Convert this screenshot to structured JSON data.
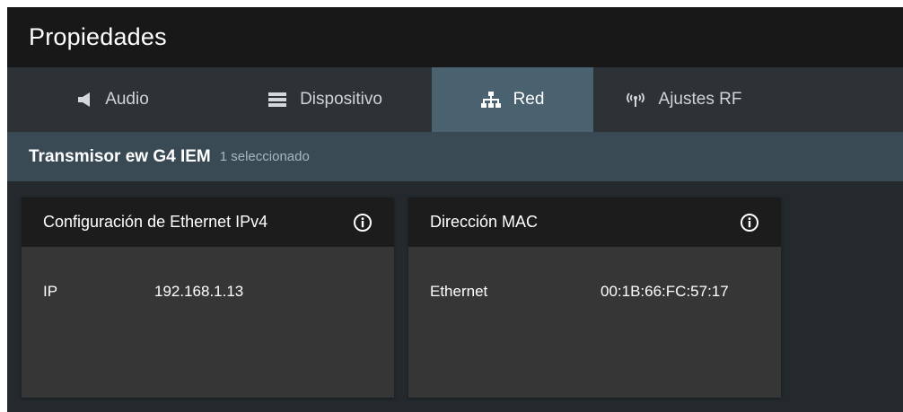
{
  "window": {
    "title": "Propiedades"
  },
  "tabs": [
    {
      "label": "Audio",
      "icon": "speaker-icon",
      "active": false
    },
    {
      "label": "Dispositivo",
      "icon": "device-icon",
      "active": false
    },
    {
      "label": "Red",
      "icon": "network-icon",
      "active": true
    },
    {
      "label": "Ajustes RF",
      "icon": "antenna-icon",
      "active": false
    }
  ],
  "device": {
    "name": "Transmisor ew G4 IEM",
    "selection": "1 seleccionado"
  },
  "cards": {
    "ipv4": {
      "title": "Configuración de Ethernet IPv4",
      "info_icon": "info-icon",
      "rows": [
        {
          "label": "IP",
          "value": "192.168.1.13"
        }
      ]
    },
    "mac": {
      "title": "Dirección MAC",
      "info_icon": "info-icon",
      "rows": [
        {
          "label": "Ethernet",
          "value": "00:1B:66:FC:57:17"
        }
      ]
    }
  },
  "colors": {
    "titlebar_bg": "#181818",
    "tabbar_bg": "#2c3235",
    "active_tab_bg": "#4a6170",
    "device_bar_bg": "#394a54",
    "content_bg": "#23292c",
    "card_header_bg": "#1c1c1c",
    "card_body_bg": "#363636"
  }
}
